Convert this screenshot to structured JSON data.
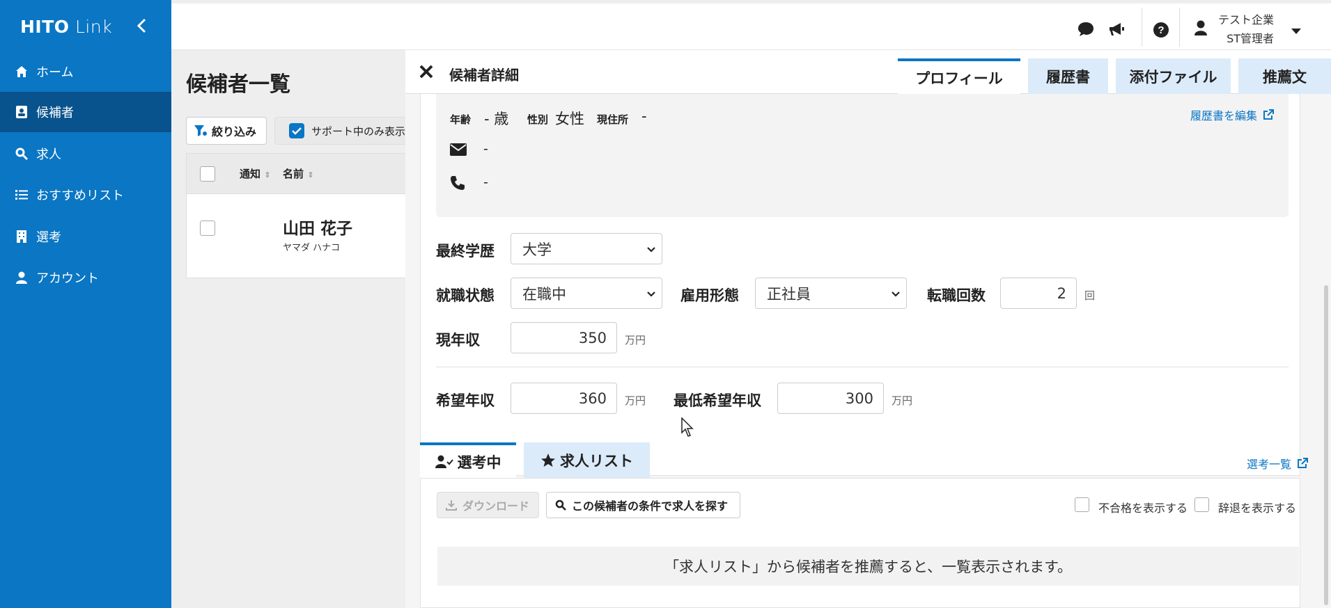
{
  "sidebar": {
    "brand_main": "HITO",
    "brand_sub": "Link",
    "items": [
      {
        "label": "ホーム",
        "icon": "home-icon"
      },
      {
        "label": "候補者",
        "icon": "id-card-icon"
      },
      {
        "label": "求人",
        "icon": "search-icon"
      },
      {
        "label": "おすすめリスト",
        "icon": "list-icon"
      },
      {
        "label": "選考",
        "icon": "building-icon"
      },
      {
        "label": "アカウント",
        "icon": "user-icon"
      }
    ]
  },
  "topbar": {
    "company": "テスト企業",
    "role": "ST管理者"
  },
  "background": {
    "title": "候補者一覧",
    "filter_label": "絞り込み",
    "support_only_label": "サポート中のみ表示",
    "col_notice": "通知",
    "col_name": "名前",
    "row_name": "山田 花子",
    "row_kana": "ヤマダ ハナコ"
  },
  "panel": {
    "title": "候補者詳細",
    "tabs": [
      "プロフィール",
      "履歴書",
      "添付ファイル",
      "推薦文"
    ],
    "info": {
      "age_label": "年齢",
      "age_value": "- 歳",
      "gender_label": "性別",
      "gender_value": "女性",
      "address_label": "現住所",
      "address_value": "-",
      "email_value": "-",
      "phone_value": "-",
      "edit_resume_link": "履歴書を編集"
    },
    "form": {
      "education_label": "最終学歴",
      "education_value": "大学",
      "employment_status_label": "就職状態",
      "employment_status_value": "在職中",
      "employment_type_label": "雇用形態",
      "employment_type_value": "正社員",
      "job_changes_label": "転職回数",
      "job_changes_value": "2",
      "job_changes_unit": "回",
      "current_income_label": "現年収",
      "current_income_value": "350",
      "desired_income_label": "希望年収",
      "desired_income_value": "360",
      "min_income_label": "最低希望年収",
      "min_income_value": "300",
      "income_unit": "万円"
    },
    "selection": {
      "tab_active": "選考中",
      "tab_job_list": "求人リスト",
      "list_link": "選考一覧",
      "download_label": "ダウンロード",
      "search_jobs_label": "この候補者の条件で求人を探す",
      "show_rejected_label": "不合格を表示する",
      "show_declined_label": "辞退を表示する",
      "empty_message": "「求人リスト」から候補者を推薦すると、一覧表示されます。"
    }
  },
  "colors": {
    "brand": "#0a76c4",
    "sidebar_active": "#08538d",
    "tab_inactive": "#dcebfa"
  }
}
